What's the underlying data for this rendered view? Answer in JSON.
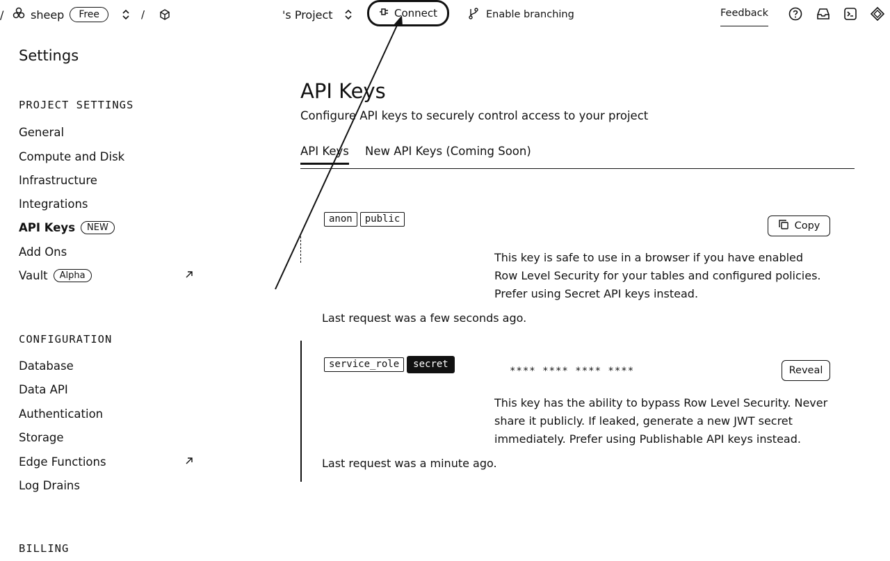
{
  "topbar": {
    "org_name": "sheep",
    "plan_badge": "Free",
    "separator": "/",
    "project_name": "'s Project",
    "connect_label": "Connect",
    "branching_label": "Enable branching",
    "feedback_label": "Feedback"
  },
  "sidebar": {
    "title": "Settings",
    "project_settings_heading": "PROJECT SETTINGS",
    "project_items": [
      {
        "label": "General"
      },
      {
        "label": "Compute and Disk"
      },
      {
        "label": "Infrastructure"
      },
      {
        "label": "Integrations"
      },
      {
        "label": "API Keys",
        "badge": "NEW"
      },
      {
        "label": "Add Ons"
      },
      {
        "label": "Vault",
        "badge": "Alpha"
      }
    ],
    "configuration_heading": "CONFIGURATION",
    "config_items": [
      {
        "label": "Database"
      },
      {
        "label": "Data API"
      },
      {
        "label": "Authentication"
      },
      {
        "label": "Storage"
      },
      {
        "label": "Edge Functions"
      },
      {
        "label": "Log Drains"
      }
    ],
    "billing_heading": "BILLING"
  },
  "main": {
    "title": "API Keys",
    "subtitle": "Configure API keys to securely control access to your project",
    "tabs": [
      {
        "label": "API Keys"
      },
      {
        "label": "New API Keys (Coming Soon)"
      }
    ],
    "anon_key": {
      "tag1": "anon",
      "tag2": "public",
      "copy_label": "Copy",
      "description": "This key is safe to use in a browser if you have enabled Row Level Security for your tables and configured policies. Prefer using Secret API keys instead.",
      "last_request": "Last request was a few seconds ago."
    },
    "service_key": {
      "tag1": "service_role",
      "tag2": "secret",
      "masked_value": "**** **** **** ****",
      "reveal_label": "Reveal",
      "description": "This key has the ability to bypass Row Level Security. Never share it publicly. If leaked, generate a new JWT secret immediately. Prefer using Publishable API keys instead.",
      "last_request": "Last request was a minute ago."
    }
  },
  "icons": {
    "org": "org-icon",
    "chevrons": "chevron-up-down-icon",
    "project": "cube-icon",
    "connect": "plug-icon",
    "branch": "branch-icon",
    "help": "help-circle-icon",
    "inbox": "inbox-icon",
    "terminal": "terminal-icon",
    "assistant": "assistant-icon",
    "copy": "copy-icon",
    "external": "external-link-icon"
  }
}
